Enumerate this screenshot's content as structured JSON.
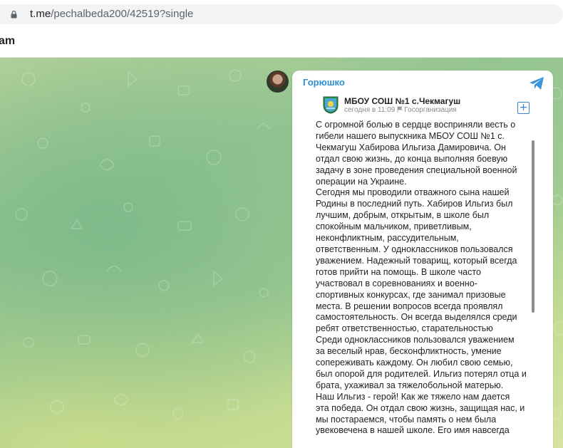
{
  "browser": {
    "url_host": "t.me",
    "url_path": "/pechalbeda200/42519?single"
  },
  "telegram_header": {
    "title": "am"
  },
  "message": {
    "sender": "Горюшко",
    "post": {
      "org_name": "МБОУ СОШ №1 с.Чекмагуш",
      "time": "сегодня в 11:09",
      "org_type": "Госорганизация",
      "lines": [
        "С огромной болью в сердце восприняли весть о",
        "гибели нашего выпускника МБОУ СОШ №1 с.",
        "Чекмагуш Хабирова Ильгиза Дамировича. Он",
        "отдал свою жизнь, до конца выполняя боевую",
        "задачу в зоне проведения специальной военной",
        "операции на Украине.",
        "Сегодня мы проводили отважного сына нашей",
        "Родины в последний путь. Хабиров Ильгиз  был",
        "лучшим, добрым, открытым, в школе был",
        "спокойным мальчиком, приветливым,",
        "неконфликтным, рассудительным,",
        "ответственным. У одноклассников пользовался",
        "уважением. Надежный товарищ, который всегда",
        "готов прийти на помощь. В школе часто",
        "участвовал в соревнованиях и военно-",
        "спортивных конкурсах, где занимал призовые",
        "места. В решении вопросов всегда проявлял",
        "самостоятельность. Он всегда выделялся среди",
        "ребят ответственностью, старательностью",
        "Среди одноклассников пользовался уважением",
        "за веселый нрав, бесконфликтность, умение",
        "сопереживать каждому. Он любил свою семью,",
        "был опорой для родителей. Ильгиз потерял отца и",
        "брата, ухаживал за тяжелобольной матерью.",
        "Наш Ильгиз - герой! Как же тяжело нам дается",
        "эта победа. Он отдал свою жизнь, защищая нас, и",
        "мы постараемся, чтобы память о нем была",
        "увековечена в нашей школе. Его имя навсегда"
      ]
    }
  },
  "icons": {
    "lock": "lock-icon",
    "share": "telegram-share-icon",
    "flag": "flag-icon",
    "add": "add-icon",
    "logo": "school-emblem-icon"
  },
  "colors": {
    "sender": "#2f8fd1",
    "accent": "#3b82d6",
    "chat_bg": "#9fca92"
  }
}
